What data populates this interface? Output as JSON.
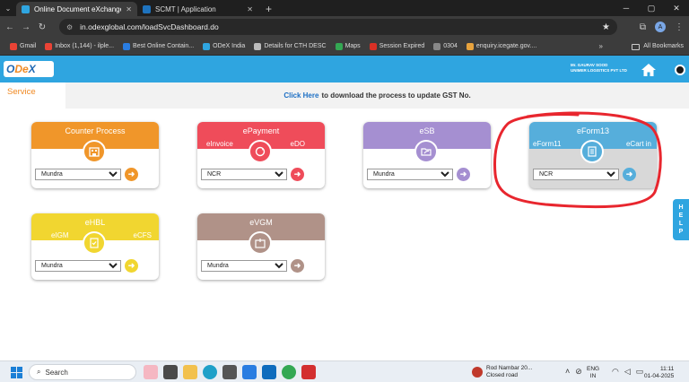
{
  "browser": {
    "tabs": [
      {
        "label": "Online Document eXchange",
        "active": true,
        "favicon_color": "#2fa5e0"
      },
      {
        "label": "SCMT | Application",
        "active": false,
        "favicon_color": "#1e73be"
      }
    ],
    "url": "in.odexglobal.com/loadSvcDashboard.do",
    "avatar_letter": "A",
    "bookmarks": [
      {
        "label": "Gmail",
        "color": "#ea4335"
      },
      {
        "label": "Inbox (1,144) - ilple...",
        "color": "#ea4335"
      },
      {
        "label": "Best Online Contain...",
        "color": "#2a7de1"
      },
      {
        "label": "ODeX India",
        "color": "#2fa5e0"
      },
      {
        "label": "Details for CTH DESC",
        "color": "#bbbbbb"
      },
      {
        "label": "Maps",
        "color": "#34a853"
      },
      {
        "label": "Session Expired",
        "color": "#d93025"
      },
      {
        "label": "0304",
        "color": "#888888"
      },
      {
        "label": "enquiry.icegate.gov....",
        "color": "#e8a33d"
      }
    ],
    "bookmarks_more": "»",
    "all_bookmarks": "All Bookmarks"
  },
  "header": {
    "logo": {
      "prefix": "O",
      "accent": "De",
      "suffix": "X"
    },
    "user_name": "Mr. GAURAV SOOD",
    "company": "UNIMER LOGISTICS PVT LTD"
  },
  "service_label": "Service",
  "notice": {
    "link": "Click Here",
    "text": "to download the process to update GST No."
  },
  "cards": [
    {
      "id": "counter",
      "title": "Counter Process",
      "sub_left": "",
      "sub_right": "",
      "selected": "Mundra"
    },
    {
      "id": "epay",
      "title": "ePayment",
      "sub_left": "eInvoice",
      "sub_right": "eDO",
      "selected": "NCR"
    },
    {
      "id": "esb",
      "title": "eSB",
      "sub_left": "",
      "sub_right": "",
      "selected": "Mundra"
    },
    {
      "id": "eform",
      "title": "eForm13",
      "sub_left": "eForm11",
      "sub_right": "eCart in",
      "selected": "NCR"
    },
    {
      "id": "ehbl",
      "title": "eHBL",
      "sub_left": "eIGM",
      "sub_right": "eCFS",
      "selected": "Mundra"
    },
    {
      "id": "evgm",
      "title": "eVGM",
      "sub_left": "",
      "sub_right": "",
      "selected": "Mundra"
    }
  ],
  "help_letters": [
    "H",
    "E",
    "L",
    "P"
  ],
  "taskbar": {
    "search_placeholder": "Search",
    "weather_title": "Rod Nambar 20...",
    "weather_sub": "Closed road",
    "lang_top": "ENG",
    "lang_bottom": "IN",
    "time": "11:11",
    "date": "01-04-2025"
  },
  "colors": {
    "odex_blue": "#2fa5e0",
    "highlight_red": "#e8262e"
  }
}
